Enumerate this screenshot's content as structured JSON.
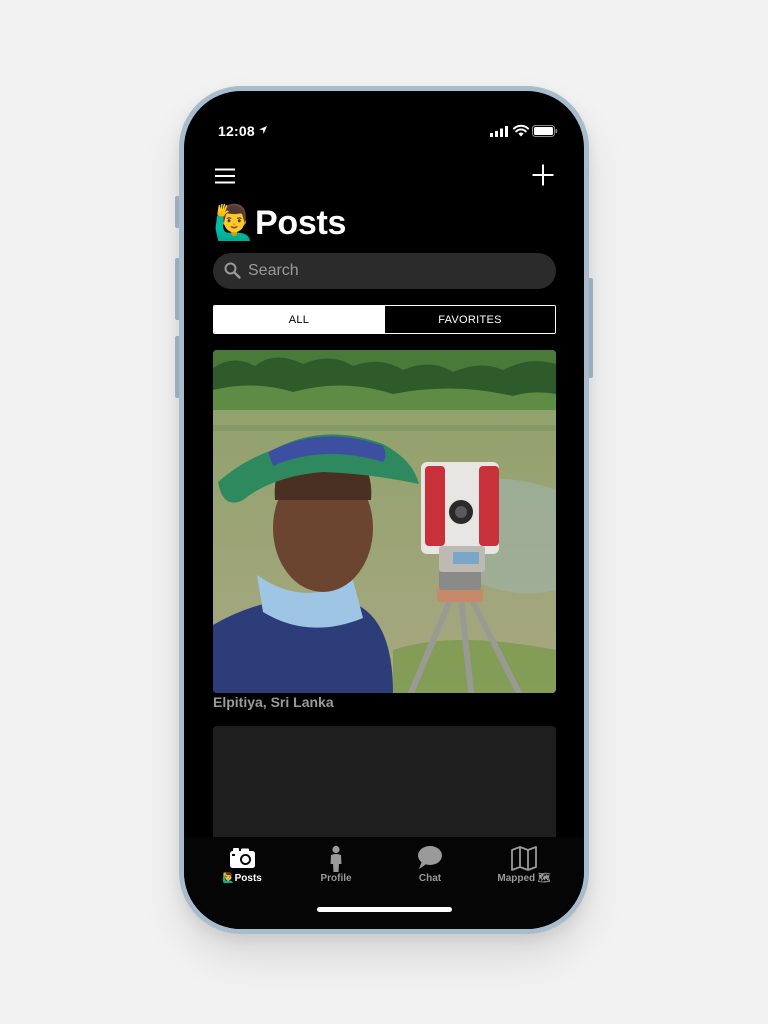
{
  "status_bar": {
    "time": "12:08"
  },
  "header": {
    "title": "🙋‍♂️Posts"
  },
  "search": {
    "placeholder": "Search",
    "value": ""
  },
  "filter": {
    "tabs": [
      "ALL",
      "FAVORITES"
    ],
    "selected": "ALL"
  },
  "posts": [
    {
      "location": "Elpitiya, Sri Lanka"
    }
  ],
  "tabbar": {
    "items": [
      {
        "label": "🙋‍♂️Posts",
        "icon": "camera-icon",
        "active": true
      },
      {
        "label": "Profile",
        "icon": "person-icon",
        "active": false
      },
      {
        "label": "Chat",
        "icon": "chat-bubble-icon",
        "active": false
      },
      {
        "label": "Mapped 🗺",
        "icon": "map-icon",
        "active": false
      }
    ]
  },
  "colors": {
    "background": "#000000",
    "accent": "#ffffff",
    "inactive": "#9a9a9a",
    "frame": "#a9bccd"
  }
}
